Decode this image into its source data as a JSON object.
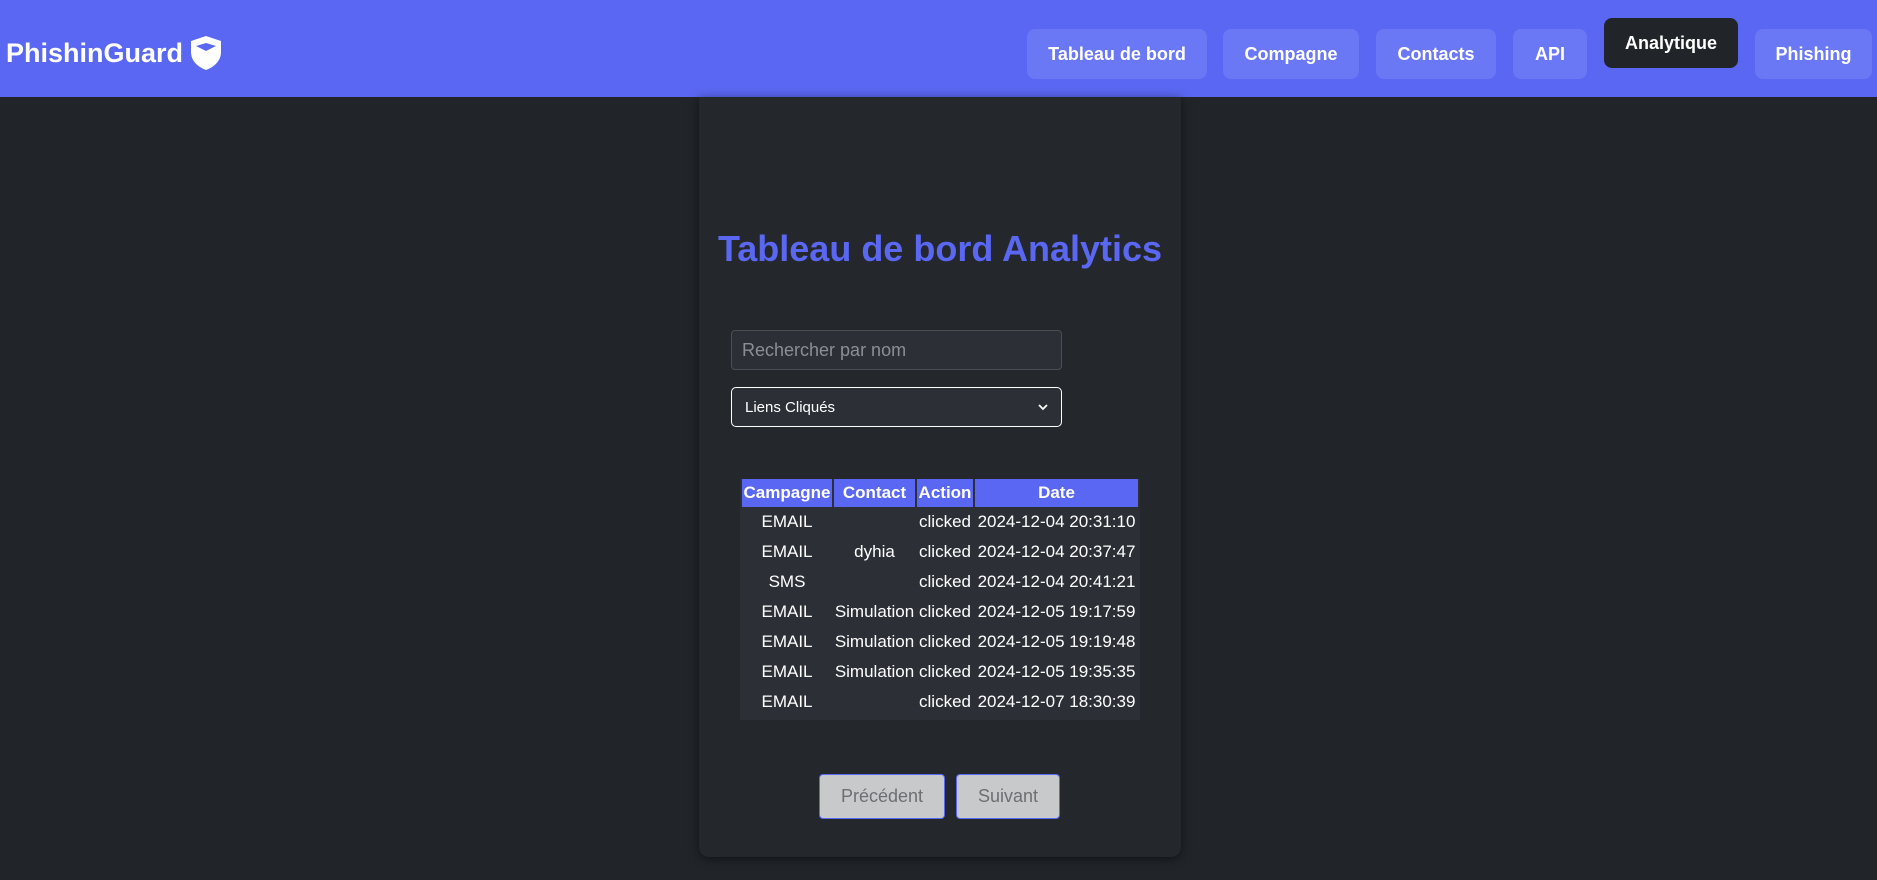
{
  "navbar": {
    "brand": "PhishinGuard",
    "items": [
      {
        "label": "Tableau de bord",
        "active": false
      },
      {
        "label": "Compagne",
        "active": false
      },
      {
        "label": "Contacts",
        "active": false
      },
      {
        "label": "API",
        "active": false
      },
      {
        "label": "Analytique",
        "active": true
      },
      {
        "label": "Phishing",
        "active": false
      }
    ]
  },
  "main": {
    "title": "Tableau de bord Analytics",
    "search": {
      "placeholder": "Rechercher par nom",
      "value": ""
    },
    "filter": {
      "selected": "Liens Cliqués"
    },
    "table": {
      "headers": [
        "Campagne",
        "Contact",
        "Action",
        "Date"
      ],
      "rows": [
        [
          "EMAIL",
          "",
          "clicked",
          "2024-12-04 20:31:10"
        ],
        [
          "EMAIL",
          "dyhia",
          "clicked",
          "2024-12-04 20:37:47"
        ],
        [
          "SMS",
          "",
          "clicked",
          "2024-12-04 20:41:21"
        ],
        [
          "EMAIL",
          "Simulation",
          "clicked",
          "2024-12-05 19:17:59"
        ],
        [
          "EMAIL",
          "Simulation",
          "clicked",
          "2024-12-05 19:19:48"
        ],
        [
          "EMAIL",
          "Simulation",
          "clicked",
          "2024-12-05 19:35:35"
        ],
        [
          "EMAIL",
          "",
          "clicked",
          "2024-12-07 18:30:39"
        ]
      ]
    },
    "pagination": {
      "prev_label": "Précédent",
      "next_label": "Suivant"
    }
  },
  "colors": {
    "accent": "#5a67f2",
    "background": "#212529",
    "card": "#24282c"
  },
  "icons": {
    "brand": "shield-icon",
    "select": "chevron-down-icon"
  }
}
